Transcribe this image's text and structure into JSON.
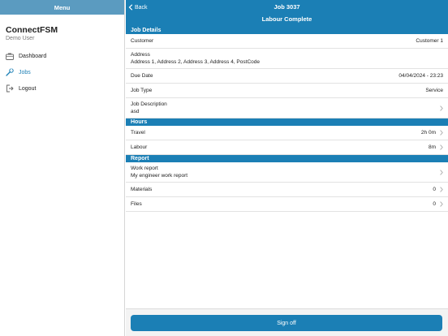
{
  "sidebar": {
    "header": "Menu",
    "app_name": "ConnectFSM",
    "user": "Demo User",
    "items": [
      {
        "label": "Dashboard",
        "icon": "briefcase-icon"
      },
      {
        "label": "Jobs",
        "icon": "wrench-icon",
        "active": true
      },
      {
        "label": "Logout",
        "icon": "logout-icon"
      }
    ]
  },
  "topbar": {
    "back": "Back",
    "title": "Job 3037",
    "status": "Labour Complete"
  },
  "sections": {
    "job_details": {
      "header": "Job Details",
      "customer_label": "Customer",
      "customer_value": "Customer 1",
      "address_label": "Address",
      "address_value": "Address 1, Address 2, Address 3, Address 4, PostCode",
      "due_label": "Due Date",
      "due_value": "04/04/2024 - 23:23",
      "type_label": "Job Type",
      "type_value": "Service",
      "desc_label": "Job Description",
      "desc_value": "asd"
    },
    "hours": {
      "header": "Hours",
      "travel_label": "Travel",
      "travel_value": "2h 0m",
      "labour_label": "Labour",
      "labour_value": "8m"
    },
    "report": {
      "header": "Report",
      "work_label": "Work report",
      "work_value": "My engineer work report",
      "materials_label": "Materials",
      "materials_value": "0",
      "files_label": "Files",
      "files_value": "0"
    }
  },
  "footer": {
    "signoff": "Sign off"
  },
  "colors": {
    "primary": "#1b7fb5",
    "sidebar_header": "#5b9bc0"
  }
}
